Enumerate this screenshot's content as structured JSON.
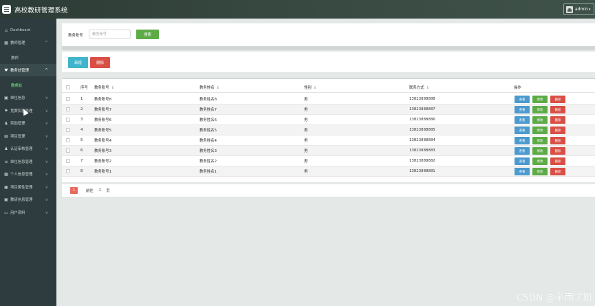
{
  "header": {
    "title": "高校教研管理系统",
    "user": "admin",
    "menu_icon": "hamburger-icon",
    "caret": "▾"
  },
  "sidebar": {
    "items": [
      {
        "label": "Dashboard",
        "icon": "home-icon",
        "glyph": "⌂",
        "chevron": ""
      },
      {
        "label": "教师管理",
        "icon": "grid-icon",
        "glyph": "▦",
        "chevron": "^"
      },
      {
        "label": "教务处管理",
        "icon": "pin-icon",
        "glyph": "♥",
        "chevron": "^"
      },
      {
        "label": "单位信息",
        "icon": "building-icon",
        "glyph": "▣",
        "chevron": "∨"
      },
      {
        "label": "竞赛实验管理",
        "icon": "flag-icon",
        "glyph": "⚑",
        "chevron": "∨"
      },
      {
        "label": "奖励管理",
        "icon": "user-icon",
        "glyph": "♟",
        "chevron": "∨"
      },
      {
        "label": "项目管理",
        "icon": "list-icon",
        "glyph": "▤",
        "chevron": "∨"
      },
      {
        "label": "认证审核管理",
        "icon": "user-check-icon",
        "glyph": "♟",
        "chevron": "∨"
      },
      {
        "label": "单位信息管理",
        "icon": "sliders-icon",
        "glyph": "≡",
        "chevron": "∨"
      },
      {
        "label": "个人信息管理",
        "icon": "grid-icon",
        "glyph": "▦",
        "chevron": "∨"
      },
      {
        "label": "项目属性管理",
        "icon": "tag-icon",
        "glyph": "▣",
        "chevron": "∨"
      },
      {
        "label": "教研信息管理",
        "icon": "briefcase-icon",
        "glyph": "▣",
        "chevron": "∨"
      },
      {
        "label": "用户资料",
        "icon": "card-icon",
        "glyph": "▭",
        "chevron": "∨"
      }
    ],
    "sub_teacher": "教师",
    "sub_office": "教务处"
  },
  "search": {
    "label": "教务账号",
    "placeholder": "教务账号",
    "button": "搜索"
  },
  "actions": {
    "add": "新增",
    "delete": "删除"
  },
  "table": {
    "headers": {
      "no": "序号",
      "account": "教务账号",
      "name": "教务姓名",
      "sex": "性别",
      "phone": "联系方式",
      "ops": "操作"
    },
    "sort_glyph": "⇕",
    "row_buttons": {
      "view": "查看",
      "edit": "修改",
      "delete": "删除"
    },
    "rows": [
      {
        "no": "1",
        "account": "教务账号8",
        "name": "教务姓名8",
        "sex": "男",
        "phone": "13823888888"
      },
      {
        "no": "2",
        "account": "教务账号7",
        "name": "教务姓名7",
        "sex": "男",
        "phone": "13823888887"
      },
      {
        "no": "3",
        "account": "教务账号6",
        "name": "教务姓名6",
        "sex": "男",
        "phone": "13823888886"
      },
      {
        "no": "4",
        "account": "教务账号5",
        "name": "教务姓名5",
        "sex": "男",
        "phone": "13823888885"
      },
      {
        "no": "5",
        "account": "教务账号4",
        "name": "教务姓名4",
        "sex": "男",
        "phone": "13823888884"
      },
      {
        "no": "6",
        "account": "教务账号3",
        "name": "教务姓名3",
        "sex": "男",
        "phone": "13823888883"
      },
      {
        "no": "7",
        "account": "教务账号2",
        "name": "教务姓名2",
        "sex": "男",
        "phone": "13823888882"
      },
      {
        "no": "8",
        "account": "教务账号1",
        "name": "教务姓名1",
        "sex": "男",
        "phone": "13823888881"
      }
    ]
  },
  "pager": {
    "current": "1",
    "goto": "前往",
    "page_input": "1",
    "page_unit": "页"
  },
  "watermark": "CSDN @辛雨学姐",
  "colors": {
    "topbar": "#36473f",
    "sidebar": "#2e3c40",
    "green": "#5dab47",
    "blue": "#4b9ad0",
    "cyan": "#3fb5cd",
    "red": "#d94f46"
  }
}
